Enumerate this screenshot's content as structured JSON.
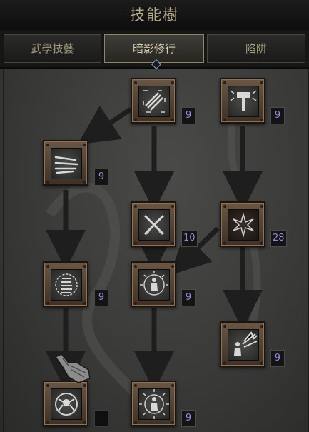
{
  "title": "技能樹",
  "tabs": [
    {
      "label": "武學技藝"
    },
    {
      "label": "暗影修行"
    },
    {
      "label": "陷阱"
    }
  ],
  "active_tab": "暗影修行",
  "skills": [
    {
      "id": "claw-slash",
      "icon": "claw-slash-icon",
      "rank": "9"
    },
    {
      "id": "hammer-blast",
      "icon": "hammer-blast-icon",
      "rank": "9"
    },
    {
      "id": "triple-claws",
      "icon": "triple-claws-icon",
      "rank": "9"
    },
    {
      "id": "crossed-blades",
      "icon": "crossed-blades-icon",
      "rank": "10"
    },
    {
      "id": "shadow-star",
      "icon": "shadow-star-icon",
      "rank": "28"
    },
    {
      "id": "coiled-tower",
      "icon": "coiled-tower-icon",
      "rank": "9"
    },
    {
      "id": "radiant-figure",
      "icon": "radiant-figure-icon",
      "rank": "9"
    },
    {
      "id": "blast-figure",
      "icon": "blast-figure-icon",
      "rank": "9"
    },
    {
      "id": "spider-aura",
      "icon": "spider-aura-icon",
      "rank": ""
    },
    {
      "id": "burst-figure",
      "icon": "burst-figure-icon",
      "rank": "9"
    }
  ],
  "colors": {
    "rank_text": "#8f8cd8",
    "title": "#b5a98d",
    "node_frame": "#6a5644"
  }
}
